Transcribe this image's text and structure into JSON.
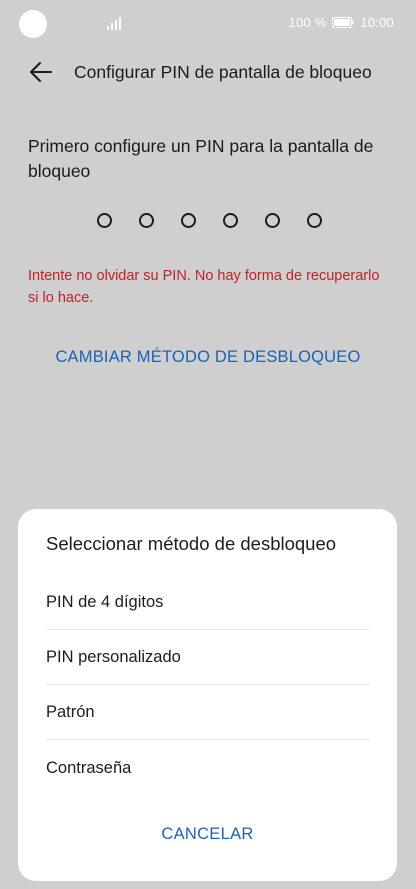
{
  "status_bar": {
    "battery_percent": "100 %",
    "time": "10:00"
  },
  "header": {
    "title": "Configurar PIN de pantalla de bloqueo"
  },
  "main": {
    "instruction": "Primero configure un PIN para la pantalla de bloqueo",
    "pin_length": 6,
    "warning": "Intente no olvidar su PIN. No hay forma de recuperarlo si lo hace.",
    "change_method_label": "CAMBIAR MÉTODO DE DESBLOQUEO"
  },
  "sheet": {
    "title": "Seleccionar método de desbloqueo",
    "options": [
      {
        "label": "PIN de 4 dígitos"
      },
      {
        "label": "PIN personalizado"
      },
      {
        "label": "Patrón"
      },
      {
        "label": "Contraseña"
      }
    ],
    "cancel_label": "CANCELAR"
  },
  "colors": {
    "accent_blue": "#1a62b8",
    "warning_red": "#c42026",
    "scrim_background": "#cfcfcf"
  },
  "icons": {
    "back": "arrow-left-icon",
    "signal": "signal-icon",
    "battery": "battery-icon"
  }
}
